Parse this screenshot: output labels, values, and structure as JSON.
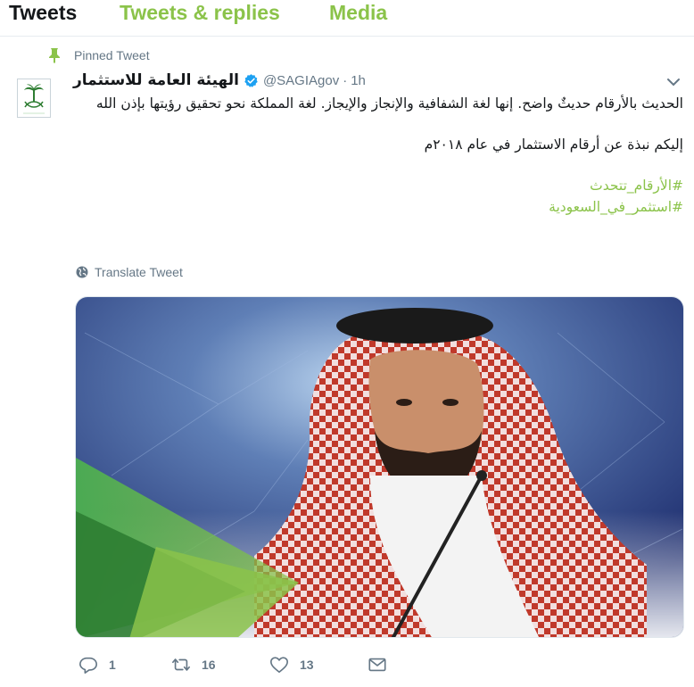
{
  "tabs": {
    "tweets": "Tweets",
    "replies": "Tweets & replies",
    "media": "Media"
  },
  "pinned": {
    "label": "Pinned Tweet",
    "icon": "pin-icon"
  },
  "tweet": {
    "display_name": "الهيئة العامة للاستثمار",
    "handle": "@SAGIAgov",
    "separator": "·",
    "time": "1h",
    "text_para1": "الحديث بالأرقام حديثٌ واضح. إنها لغة الشفافية والإنجاز والإيجاز. لغة المملكة نحو تحقيق رؤيتها بإذن الله",
    "text_para2": "إليكم نبذة عن أرقام الاستثمار في عام ٢٠١٨م",
    "hashtag1": "#الأرقام_تتحدث",
    "hashtag2": "#استثمر_في_السعودية",
    "translate_label": "Translate Tweet"
  },
  "actions": {
    "reply_count": "1",
    "retweet_count": "16",
    "like_count": "13"
  },
  "colors": {
    "accent": "#8bc34a",
    "muted": "#657786",
    "verified": "#1da1f2"
  }
}
